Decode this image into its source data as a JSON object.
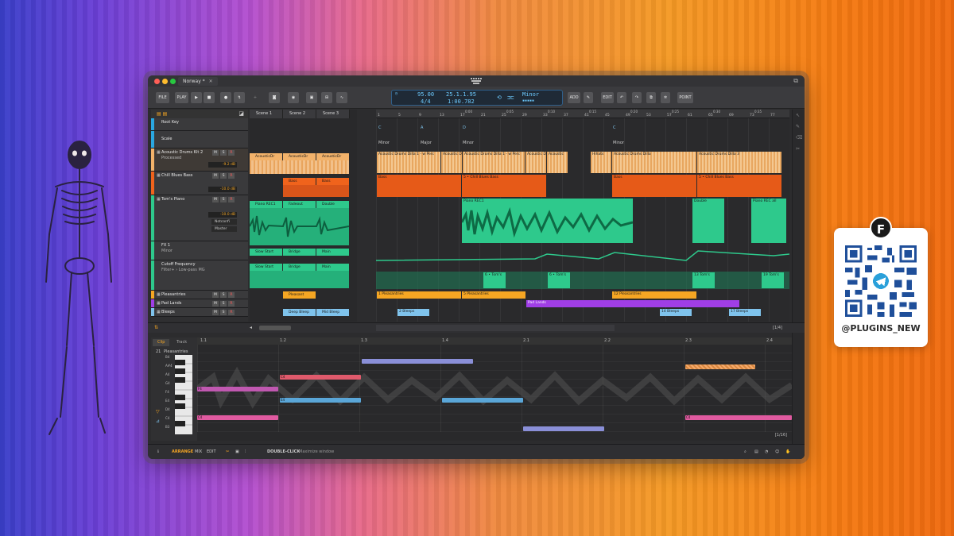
{
  "window": {
    "document_tab": "Norway *",
    "tab_close": "✕"
  },
  "toolbar": {
    "file": "FILE",
    "play_menu": "PLAY",
    "add": "ADD",
    "edit": "EDIT",
    "point": "POINT"
  },
  "transport": {
    "tempo": "95.00",
    "time_signature": "4/4",
    "position": "25.1.1.95",
    "time": "1:00.782",
    "key": "Minor"
  },
  "tracks": [
    {
      "name": "Root Key",
      "color": "#2aa7e0"
    },
    {
      "name": "Scale",
      "color": "#2aa7e0"
    },
    {
      "name": "Acoustic Drums Kit 2",
      "sub": "Processed",
      "color": "#f2b26a",
      "volume": "-9.2 dB"
    },
    {
      "name": "Chill Blues Bass",
      "color": "#f0631c",
      "volume": "-10.0 dB"
    },
    {
      "name": "Tom's Piano",
      "color": "#2ec98c",
      "volume": "-10.0 dB",
      "input": "Notconfi",
      "output": "Master"
    },
    {
      "name": "FX 1",
      "sub": "Minor",
      "color": "#2ec98c"
    },
    {
      "name": "Cutoff Frequency",
      "sub": "Filter+ › Low-pass MG",
      "color": "#2ec98c"
    },
    {
      "name": "Pleasantries",
      "color": "#f5a623"
    },
    {
      "name": "Pad Lands",
      "color": "#a03ee6"
    },
    {
      "name": "Bleeps",
      "color": "#7fc3ec"
    }
  ],
  "buttons": {
    "mute": "M",
    "solo": "S",
    "arm": "R"
  },
  "scenes": [
    "Scene 1",
    "Scene 2",
    "Scene 3"
  ],
  "launcher_clips": {
    "drums": [
      "AcousticDr",
      "AcousticDr",
      "AcousticDr"
    ],
    "bass": [
      "Bass",
      "Bass"
    ],
    "piano": [
      "Piano REC1",
      "Fadeout",
      "Double"
    ],
    "fx": [
      "Slow Start",
      "Bridge",
      "Main"
    ],
    "cutoff": [
      "Slow Start",
      "Bridge",
      "Main"
    ],
    "pleasantries": [
      "Pleasant"
    ],
    "bleeps": [
      "Deep Bleep",
      "Mid Bleep"
    ]
  },
  "ruler": [
    "1",
    "5",
    "9",
    "13",
    "17",
    "21",
    "25",
    "29",
    "33",
    "37",
    "41",
    "45",
    "49",
    "53",
    "57",
    "61",
    "65",
    "69",
    "73",
    "77",
    "81"
  ],
  "ruler_times": [
    "0:00",
    "0:05",
    "0:10",
    "0:15",
    "0:20",
    "0:25",
    "0:30",
    "0:35",
    "0:40",
    "0:45"
  ],
  "arranger": {
    "root_keys": [
      "C",
      "A",
      "D",
      "C"
    ],
    "scales": [
      "Minor",
      "Major",
      "Minor",
      "Minor"
    ],
    "drums": [
      "Acoustic Drums Dilla 1 - w Perc",
      "Acoustic D",
      "Acoustic Drums Dilla 1 - w Perc",
      "Acoustic D",
      "Acoustic",
      "Hihats",
      "Acoustic Drums Dilla",
      "Acoustic Drums Dilla 3"
    ],
    "bass": [
      "Bass",
      "5 • Chill Blues Bass",
      "Bass",
      "5 • Chill Blues Bass"
    ],
    "piano": [
      "Piano REC1",
      "Double",
      "Piano REC all"
    ],
    "cutoff": [
      "6 • Tom's",
      "6 • Tom's",
      "13 Tom's",
      "19 Tom's"
    ],
    "pleasantries": [
      "1 Pleasantries",
      "5 Pleasantries",
      "12 Pleasantries"
    ],
    "pad": [
      "Pad Lands"
    ],
    "bleeps": [
      "2 Bleeps",
      "14 Bleeps",
      "17 Bleeps"
    ]
  },
  "page_indicator_top": "[1/4]",
  "editor": {
    "tabs": [
      "Clip",
      "Track"
    ],
    "clip_number": "21",
    "clip_name": "Pleasantries",
    "ruler": [
      "1.1",
      "1.2",
      "1.3",
      "1.4",
      "2.1",
      "2.2",
      "2.3",
      "2.4"
    ],
    "keys": [
      "B4",
      "A#4",
      "A4",
      "G4",
      "F4",
      "E4",
      "D4",
      "C4",
      "B3"
    ],
    "notes": [
      "C4",
      "F4",
      "E4",
      "C4",
      "C4"
    ],
    "page_indicator": "[1/16]"
  },
  "statusbar": {
    "arrange": "ARRANGE",
    "mix": "MIX",
    "edit": "EDIT",
    "hint_key": "DOUBLE-CLICK",
    "hint_text": "Maximize window"
  },
  "qr": {
    "handle": "@PLUGINS_NEW",
    "logo_letter": "F"
  },
  "colors": {
    "drums": "#f2b26a",
    "bass": "#f0631c",
    "piano": "#2ec98c",
    "pleasantries": "#f5a623",
    "pad": "#a03ee6",
    "bleeps": "#7fc3ec",
    "accent": "#f5a623",
    "transport": "#6ecbff"
  }
}
